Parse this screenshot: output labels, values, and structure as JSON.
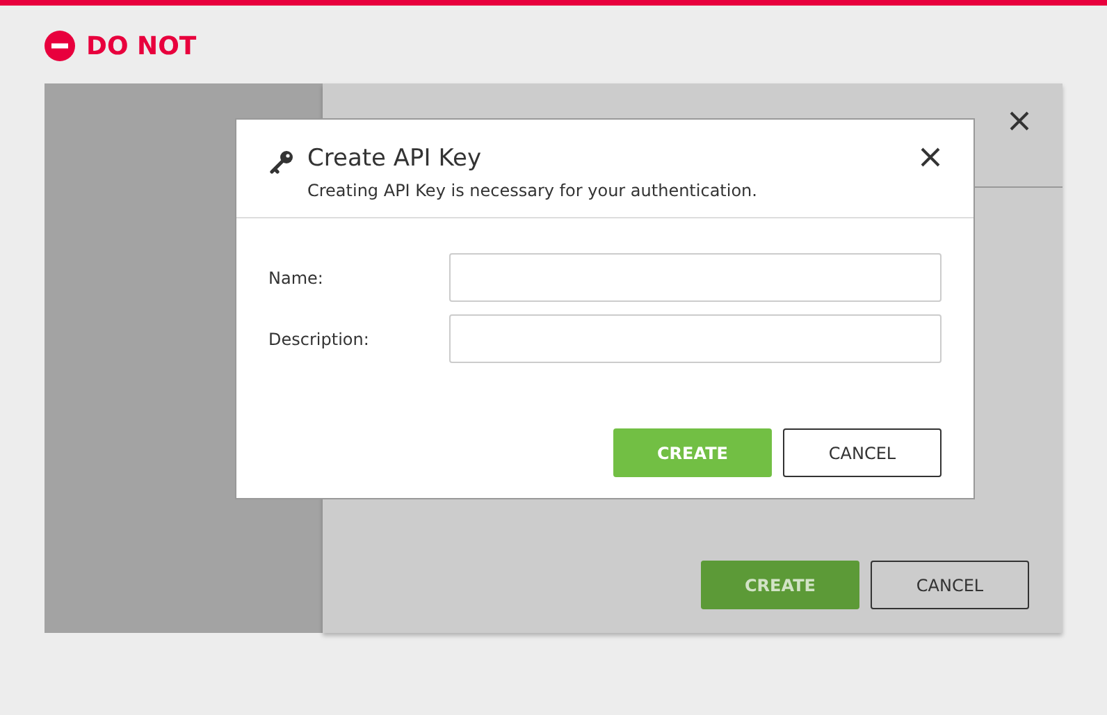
{
  "badge": {
    "label": "DO NOT"
  },
  "background_dialog": {
    "buttons": [
      {
        "label": "CREATE",
        "kind": "primary"
      },
      {
        "label": "CANCEL",
        "kind": "secondary"
      }
    ]
  },
  "dialog": {
    "title": "Create API Key",
    "subtitle": "Creating API Key is necessary for your authentication.",
    "fields": [
      {
        "label": "Name:"
      },
      {
        "label": "Description:"
      }
    ],
    "buttons": [
      {
        "label": "CREATE",
        "kind": "primary"
      },
      {
        "label": "CANCEL",
        "kind": "secondary"
      }
    ]
  }
}
